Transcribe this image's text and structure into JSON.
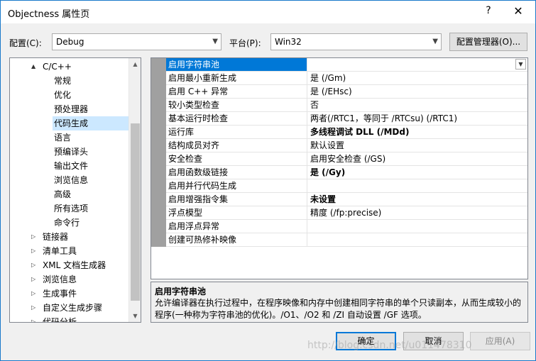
{
  "window": {
    "title": "Objectness 属性页",
    "help": "?",
    "close": "✕"
  },
  "toolbar": {
    "config_label": "配置(C):",
    "config_value": "Debug",
    "platform_label": "平台(P):",
    "platform_value": "Win32",
    "config_manager": "配置管理器(O)..."
  },
  "tree": [
    {
      "label": "C/C++",
      "expander": "▲"
    },
    {
      "label": "常规"
    },
    {
      "label": "优化"
    },
    {
      "label": "预处理器"
    },
    {
      "label": "代码生成",
      "selected": true
    },
    {
      "label": "语言"
    },
    {
      "label": "预编译头"
    },
    {
      "label": "输出文件"
    },
    {
      "label": "浏览信息"
    },
    {
      "label": "高级"
    },
    {
      "label": "所有选项"
    },
    {
      "label": "命令行"
    },
    {
      "label": "链接器",
      "expander": "▷"
    },
    {
      "label": "清单工具",
      "expander": "▷"
    },
    {
      "label": "XML 文档生成器",
      "expander": "▷"
    },
    {
      "label": "浏览信息",
      "expander": "▷"
    },
    {
      "label": "生成事件",
      "expander": "▷"
    },
    {
      "label": "自定义生成步骤",
      "expander": "▷"
    },
    {
      "label": "代码分析",
      "expander": "▷"
    }
  ],
  "grid": [
    {
      "name": "启用字符串池",
      "value": "",
      "selected": true
    },
    {
      "name": "启用最小重新生成",
      "value": "是 (/Gm)"
    },
    {
      "name": "启用 C++ 异常",
      "value": "是 (/EHsc)"
    },
    {
      "name": "较小类型检查",
      "value": "否"
    },
    {
      "name": "基本运行时检查",
      "value": "两者(/RTC1，等同于 /RTCsu) (/RTC1)"
    },
    {
      "name": "运行库",
      "value": "多线程调试 DLL (/MDd)",
      "bold": true
    },
    {
      "name": "结构成员对齐",
      "value": "默认设置"
    },
    {
      "name": "安全检查",
      "value": "启用安全检查 (/GS)"
    },
    {
      "name": "启用函数级链接",
      "value": "是 (/Gy)",
      "bold": true
    },
    {
      "name": "启用并行代码生成",
      "value": ""
    },
    {
      "name": "启用增强指令集",
      "value": "未设置",
      "bold": true
    },
    {
      "name": "浮点模型",
      "value": "精度 (/fp:precise)"
    },
    {
      "name": "启用浮点异常",
      "value": ""
    },
    {
      "name": "创建可热修补映像",
      "value": ""
    }
  ],
  "description": {
    "title": "启用字符串池",
    "text": "允许编译器在执行过程中，在程序映像和内存中创建相同字符串的单个只读副本，从而生成较小的程序(一种称为字符串池的优化)。/O1、/O2 和 /ZI 自动设置 /GF 选项。"
  },
  "buttons": {
    "ok": "确定",
    "cancel": "取消",
    "apply": "应用(A)"
  },
  "watermark": "http://blog.csdn.net/u011478310"
}
